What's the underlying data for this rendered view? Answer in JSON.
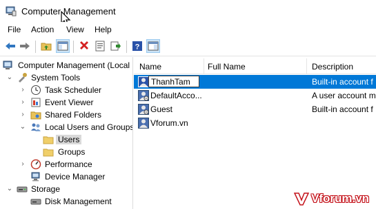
{
  "window": {
    "title": "Computer Management"
  },
  "menu": [
    "File",
    "Action",
    "View",
    "Help"
  ],
  "toolbar": {
    "buttons": [
      "back-icon",
      "forward-icon",
      "up-folder-icon",
      "show-tree-icon",
      "delete-icon",
      "properties-icon",
      "export-icon",
      "help-icon",
      "show-action-pane-icon"
    ]
  },
  "tree": {
    "items": [
      {
        "label": "Computer Management (Local",
        "icon": "computer-management-icon"
      },
      {
        "label": "System Tools",
        "icon": "tools-icon"
      },
      {
        "label": "Task Scheduler",
        "icon": "clock-icon"
      },
      {
        "label": "Event Viewer",
        "icon": "event-viewer-icon"
      },
      {
        "label": "Shared Folders",
        "icon": "shared-folder-icon"
      },
      {
        "label": "Local Users and Groups",
        "icon": "users-groups-icon"
      },
      {
        "label": "Users",
        "icon": "folder-icon"
      },
      {
        "label": "Groups",
        "icon": "folder-icon"
      },
      {
        "label": "Performance",
        "icon": "performance-icon"
      },
      {
        "label": "Device Manager",
        "icon": "device-manager-icon"
      },
      {
        "label": "Storage",
        "icon": "storage-icon"
      },
      {
        "label": "Disk Management",
        "icon": "disk-icon"
      }
    ]
  },
  "list": {
    "columns": [
      "Name",
      "Full Name",
      "Description"
    ],
    "rows": [
      {
        "name": "ThanhTam",
        "full_name": "",
        "description": "Built-in account f",
        "editing": true
      },
      {
        "name": "DefaultAcco...",
        "full_name": "",
        "description": "A user account m"
      },
      {
        "name": "Guest",
        "full_name": "",
        "description": "Built-in account f"
      },
      {
        "name": "Vforum.vn",
        "full_name": "",
        "description": ""
      }
    ]
  },
  "watermark": {
    "text": "Vforum.vn"
  },
  "colors": {
    "selection": "#0078d7",
    "tree_selected": "#d9d9d9",
    "watermark_red": "#c4121a"
  }
}
